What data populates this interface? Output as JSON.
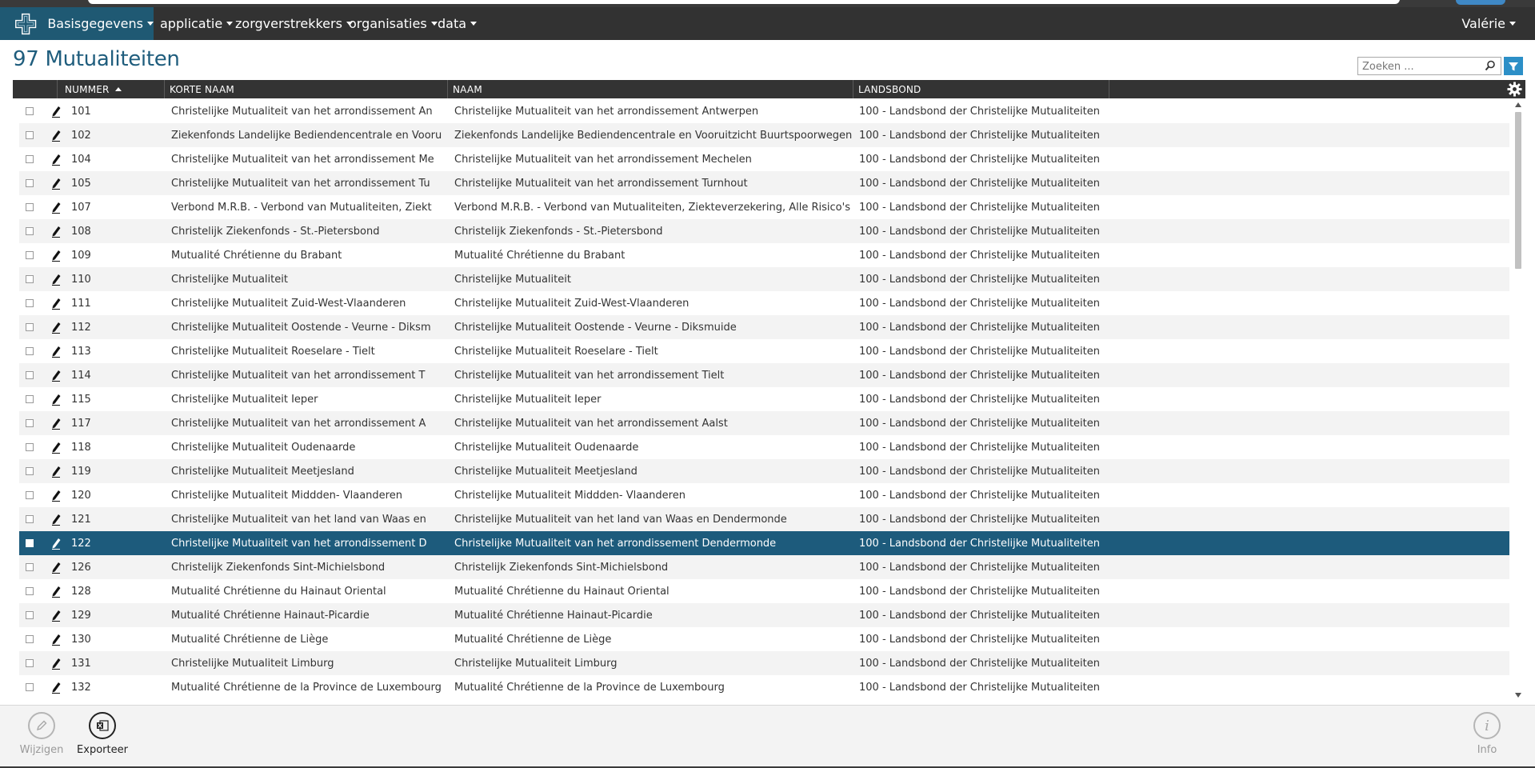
{
  "navbar": {
    "brand_label": "Basisgegevens",
    "menu": [
      "applicatie",
      "zorgverstrekkers",
      "organisaties",
      "data"
    ],
    "user": "Valérie"
  },
  "page": {
    "title": "97 Mutualiteiten"
  },
  "search": {
    "placeholder": "Zoeken ..."
  },
  "table": {
    "columns": [
      "NUMMER",
      "KORTE NAAM",
      "NAAM",
      "LANDSBOND"
    ],
    "sort": {
      "column": "NUMMER",
      "direction": "asc"
    },
    "rows": [
      {
        "nummer": "101",
        "korte_naam": "Christelijke Mutualiteit van het arrondissement An",
        "naam": "Christelijke Mutualiteit van het arrondissement Antwerpen",
        "landsbond": "100 - Landsbond der Christelijke Mutualiteiten"
      },
      {
        "nummer": "102",
        "korte_naam": "Ziekenfonds Landelijke Bediendencentrale en Vooru",
        "naam": "Ziekenfonds Landelijke Bediendencentrale en Vooruitzicht Buurtspoorwegen",
        "landsbond": "100 - Landsbond der Christelijke Mutualiteiten"
      },
      {
        "nummer": "104",
        "korte_naam": "Christelijke Mutualiteit van het arrondissement Me",
        "naam": "Christelijke Mutualiteit van het arrondissement Mechelen",
        "landsbond": "100 - Landsbond der Christelijke Mutualiteiten"
      },
      {
        "nummer": "105",
        "korte_naam": "Christelijke Mutualiteit van het arrondissement Tu",
        "naam": "Christelijke Mutualiteit van het arrondissement Turnhout",
        "landsbond": "100 - Landsbond der Christelijke Mutualiteiten"
      },
      {
        "nummer": "107",
        "korte_naam": "Verbond M.R.B. - Verbond van Mutualiteiten, Ziekt",
        "naam": "Verbond M.R.B. - Verbond van Mutualiteiten, Ziekteverzekering, Alle Risico's",
        "landsbond": "100 - Landsbond der Christelijke Mutualiteiten"
      },
      {
        "nummer": "108",
        "korte_naam": "Christelijk Ziekenfonds - St.-Pietersbond",
        "naam": "Christelijk Ziekenfonds - St.-Pietersbond",
        "landsbond": "100 - Landsbond der Christelijke Mutualiteiten"
      },
      {
        "nummer": "109",
        "korte_naam": "Mutualité Chrétienne du Brabant",
        "naam": "Mutualité Chrétienne du Brabant",
        "landsbond": "100 - Landsbond der Christelijke Mutualiteiten"
      },
      {
        "nummer": "110",
        "korte_naam": "Christelijke Mutualiteit",
        "naam": "Christelijke Mutualiteit",
        "landsbond": "100 - Landsbond der Christelijke Mutualiteiten"
      },
      {
        "nummer": "111",
        "korte_naam": "Christelijke Mutualiteit Zuid-West-Vlaanderen",
        "naam": "Christelijke Mutualiteit Zuid-West-Vlaanderen",
        "landsbond": "100 - Landsbond der Christelijke Mutualiteiten"
      },
      {
        "nummer": "112",
        "korte_naam": "Christelijke Mutualiteit Oostende - Veurne - Diksm",
        "naam": "Christelijke Mutualiteit Oostende - Veurne - Diksmuide",
        "landsbond": "100 - Landsbond der Christelijke Mutualiteiten"
      },
      {
        "nummer": "113",
        "korte_naam": "Christelijke Mutualiteit Roeselare - Tielt",
        "naam": "Christelijke Mutualiteit Roeselare - Tielt",
        "landsbond": "100 - Landsbond der Christelijke Mutualiteiten"
      },
      {
        "nummer": "114",
        "korte_naam": "Christelijke Mutualiteit van het arrondissement T",
        "naam": "Christelijke Mutualiteit van het arrondissement Tielt",
        "landsbond": "100 - Landsbond der Christelijke Mutualiteiten"
      },
      {
        "nummer": "115",
        "korte_naam": "Christelijke Mutualiteit Ieper",
        "naam": "Christelijke Mutualiteit Ieper",
        "landsbond": "100 - Landsbond der Christelijke Mutualiteiten"
      },
      {
        "nummer": "117",
        "korte_naam": "Christelijke Mutualiteit van het arrondissement A",
        "naam": "Christelijke Mutualiteit van het arrondissement Aalst",
        "landsbond": "100 - Landsbond der Christelijke Mutualiteiten"
      },
      {
        "nummer": "118",
        "korte_naam": "Christelijke Mutualiteit Oudenaarde",
        "naam": "Christelijke Mutualiteit Oudenaarde",
        "landsbond": "100 - Landsbond der Christelijke Mutualiteiten"
      },
      {
        "nummer": "119",
        "korte_naam": "Christelijke Mutualiteit Meetjesland",
        "naam": "Christelijke Mutualiteit Meetjesland",
        "landsbond": "100 - Landsbond der Christelijke Mutualiteiten"
      },
      {
        "nummer": "120",
        "korte_naam": "Christelijke Mutualiteit Middden- Vlaanderen",
        "naam": "Christelijke Mutualiteit Middden- Vlaanderen",
        "landsbond": "100 - Landsbond der Christelijke Mutualiteiten"
      },
      {
        "nummer": "121",
        "korte_naam": "Christelijke Mutualiteit van het land van Waas en",
        "naam": "Christelijke Mutualiteit van het land van Waas en Dendermonde",
        "landsbond": "100 - Landsbond der Christelijke Mutualiteiten"
      },
      {
        "nummer": "122",
        "korte_naam": "Christelijke Mutualiteit van het arrondissement D",
        "naam": "Christelijke Mutualiteit van het arrondissement Dendermonde",
        "landsbond": "100 - Landsbond der Christelijke Mutualiteiten",
        "selected": true
      },
      {
        "nummer": "126",
        "korte_naam": "Christelijk Ziekenfonds Sint-Michielsbond",
        "naam": "Christelijk Ziekenfonds Sint-Michielsbond",
        "landsbond": "100 - Landsbond der Christelijke Mutualiteiten"
      },
      {
        "nummer": "128",
        "korte_naam": "Mutualité Chrétienne du Hainaut Oriental",
        "naam": "Mutualité Chrétienne du Hainaut Oriental",
        "landsbond": "100 - Landsbond der Christelijke Mutualiteiten"
      },
      {
        "nummer": "129",
        "korte_naam": "Mutualité Chrétienne Hainaut-Picardie",
        "naam": "Mutualité Chrétienne Hainaut-Picardie",
        "landsbond": "100 - Landsbond der Christelijke Mutualiteiten"
      },
      {
        "nummer": "130",
        "korte_naam": "Mutualité Chrétienne de Liège",
        "naam": "Mutualité Chrétienne de Liège",
        "landsbond": "100 - Landsbond der Christelijke Mutualiteiten"
      },
      {
        "nummer": "131",
        "korte_naam": "Christelijke Mutualiteit Limburg",
        "naam": "Christelijke Mutualiteit Limburg",
        "landsbond": "100 - Landsbond der Christelijke Mutualiteiten"
      },
      {
        "nummer": "132",
        "korte_naam": "Mutualité Chrétienne de la Province de Luxembourg",
        "naam": "Mutualité Chrétienne de la Province de Luxembourg",
        "landsbond": "100 - Landsbond der Christelijke Mutualiteiten"
      }
    ]
  },
  "footer": {
    "edit_label": "Wijzigen",
    "export_label": "Exporteer",
    "info_label": "Info"
  },
  "icons": {
    "logo": "cross-logo-icon",
    "search": "search-icon",
    "filter": "filter-icon",
    "settings": "gear-icon",
    "row_edit": "pencil-icon",
    "edit": "pencil-circle-icon",
    "export": "excel-icon",
    "info": "info-icon"
  },
  "colors": {
    "navbar": "#323232",
    "brand": "#1f5973",
    "title": "#1f5d7d",
    "selected_row": "#1d5b7c",
    "filter_button": "#2c8fc7"
  }
}
